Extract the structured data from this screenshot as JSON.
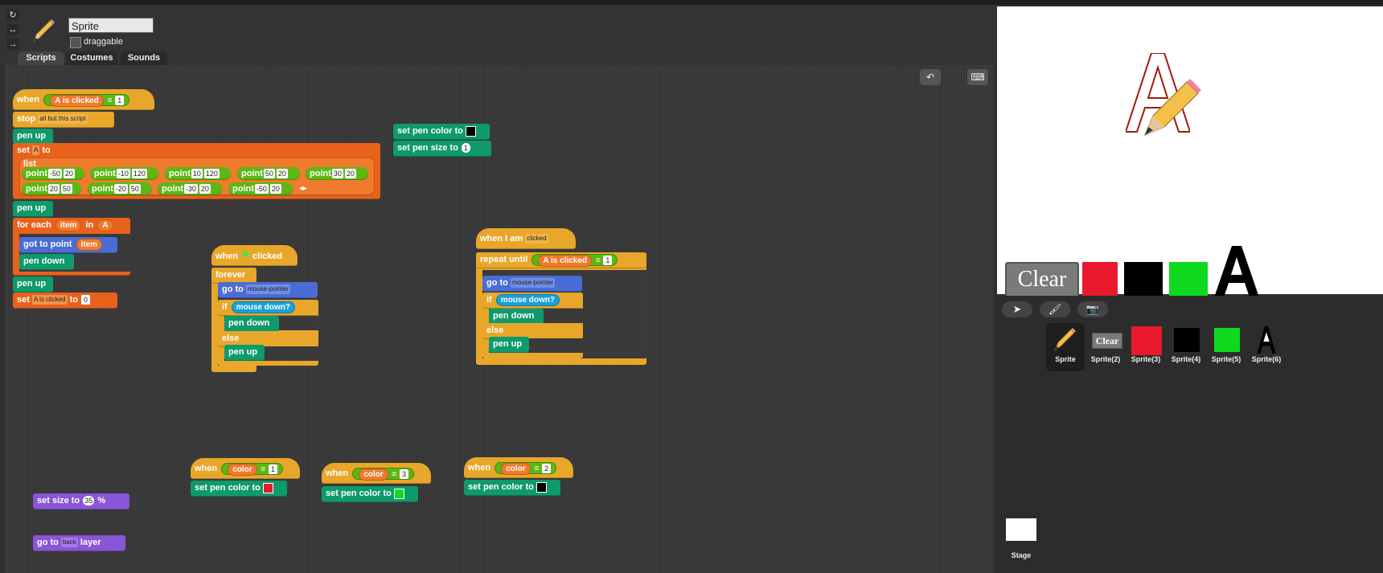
{
  "header": {
    "sprite_name": "Sprite",
    "draggable_label": "draggable",
    "tabs": [
      "Scripts",
      "Costumes",
      "Sounds"
    ]
  },
  "scripts": {
    "when_a_clicked": {
      "when": "when",
      "var": "A is clicked",
      "eq": "=",
      "val": "1"
    },
    "stop": {
      "label": "stop",
      "option": "all but this script"
    },
    "pen_up": "pen up",
    "pen_down": "pen down",
    "set_a": {
      "label": "set",
      "var": "A",
      "to": "to"
    },
    "list_label": "list",
    "point_label": "point",
    "points_row1": [
      [
        "-50",
        "20"
      ],
      [
        "-10",
        "120"
      ],
      [
        "10",
        "120"
      ],
      [
        "50",
        "20"
      ],
      [
        "30",
        "20"
      ]
    ],
    "points_row2": [
      [
        "20",
        "50"
      ],
      [
        "-20",
        "50"
      ],
      [
        "-30",
        "20"
      ],
      [
        "-50",
        "20"
      ]
    ],
    "for_each": {
      "label": "for each",
      "item": "item",
      "in": "in",
      "list": "A"
    },
    "got_to_point": {
      "label": "got to point",
      "item": "item"
    },
    "set_clicked": {
      "label": "set",
      "var": "A is clicked",
      "to": "to",
      "val": "0"
    },
    "set_pen_color": "set pen color to",
    "set_pen_size": {
      "label": "set pen size to",
      "val": "1"
    },
    "when_flag": {
      "when": "when",
      "clicked": "clicked"
    },
    "forever": "forever",
    "go_to": {
      "label": "go to",
      "target": "mouse-pointer"
    },
    "if": "if",
    "else": "else",
    "mouse_down": "mouse down?",
    "when_i_am": {
      "label": "when I am",
      "option": "clicked"
    },
    "repeat_until": {
      "label": "repeat until",
      "var": "A is clicked",
      "eq": "=",
      "val": "1"
    },
    "when_color_1": {
      "when": "when",
      "var": "color",
      "eq": "=",
      "val": "1"
    },
    "when_color_3": {
      "when": "when",
      "var": "color",
      "eq": "=",
      "val": "3"
    },
    "when_color_2": {
      "when": "when",
      "var": "color",
      "eq": "=",
      "val": "2"
    },
    "set_size": {
      "label": "set size to",
      "val": "35",
      "unit": "%"
    },
    "go_to_layer": {
      "label": "go to",
      "option": "back",
      "layer": "layer"
    }
  },
  "stage": {
    "clear_label": "Clear"
  },
  "corral": {
    "sprites": [
      "Sprite",
      "Sprite(2)",
      "Sprite(3)",
      "Sprite(4)",
      "Sprite(5)",
      "Sprite(6)"
    ],
    "clear_thumb": "Clear",
    "stage_label": "Stage"
  },
  "colors": {
    "red": "#e8192c",
    "black": "#000000",
    "green": "#0fd91f",
    "events": "#e8a72a",
    "pen": "#0f9a6b",
    "motion": "#4a6cd4",
    "variables": "#e8621c",
    "looks": "#8a55d7"
  },
  "icons": [
    "rotate-icon",
    "flip-icon",
    "arrow-right-icon",
    "pencil-icon",
    "undo-icon",
    "keyboard-icon",
    "flag-icon",
    "arrow-icon",
    "paintbrush-icon",
    "camera-icon"
  ]
}
